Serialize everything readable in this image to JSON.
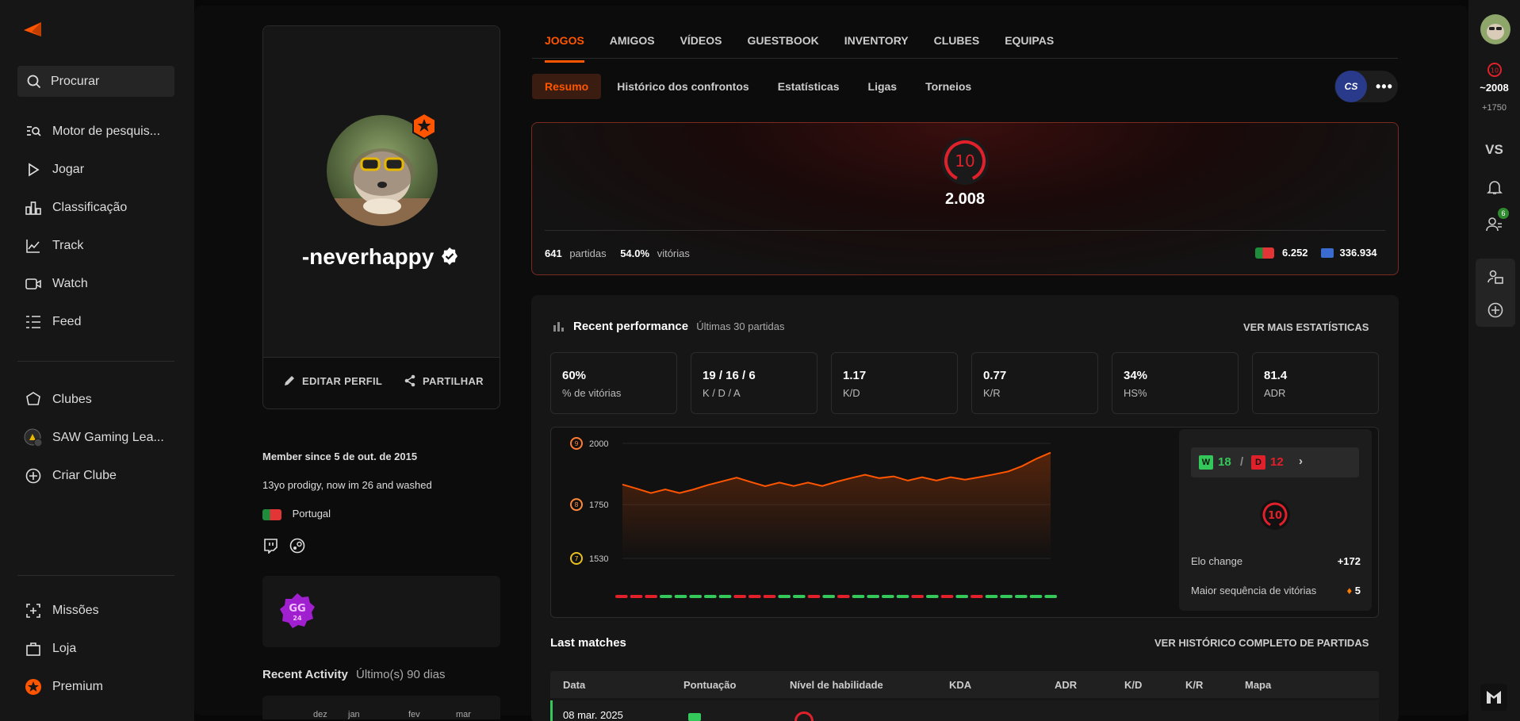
{
  "sidebar": {
    "search": "Procurar",
    "items": [
      {
        "label": "Motor de pesquis...",
        "icon": "search-engine-icon"
      },
      {
        "label": "Jogar",
        "icon": "play-icon"
      },
      {
        "label": "Classificação",
        "icon": "ranking-icon"
      },
      {
        "label": "Track",
        "icon": "chart-line-icon"
      },
      {
        "label": "Watch",
        "icon": "video-icon"
      },
      {
        "label": "Feed",
        "icon": "feed-icon"
      }
    ],
    "clubs": [
      {
        "label": "Clubes",
        "icon": "clubs-icon"
      },
      {
        "label": "SAW Gaming Lea...",
        "icon": "club-avatar"
      },
      {
        "label": "Criar Clube",
        "icon": "plus-circle-icon"
      }
    ],
    "bottom": [
      {
        "label": "Missões",
        "icon": "missions-icon"
      },
      {
        "label": "Loja",
        "icon": "shop-icon"
      },
      {
        "label": "Premium",
        "icon": "premium-icon"
      }
    ]
  },
  "profile": {
    "username": "-neverhappy",
    "edit": "EDITAR PERFIL",
    "share": "PARTILHAR",
    "member_since": "Member since 5 de out. de 2015",
    "bio": "13yo prodigy, now im 26 and washed",
    "country": "Portugal",
    "gg_badge": "GG 24",
    "recent_activity": "Recent Activity",
    "recent_activity_range": "Último(s) 90 dias",
    "activity_months": [
      "dez",
      "jan",
      "fev",
      "mar"
    ]
  },
  "tabs": [
    "JOGOS",
    "AMIGOS",
    "VÍDEOS",
    "GUESTBOOK",
    "INVENTORY",
    "CLUBES",
    "EQUIPAS"
  ],
  "subtabs": [
    "Resumo",
    "Histórico dos confrontos",
    "Estatísticas",
    "Ligas",
    "Torneios"
  ],
  "game_badge": "CS",
  "elo": {
    "level": "10",
    "value": "2.008",
    "matches": "641",
    "matches_label": "partidas",
    "winrate": "54.0%",
    "winrate_label": "vitórias",
    "country_rank": "6.252",
    "region_rank": "336.934"
  },
  "perf": {
    "title": "Recent performance",
    "subtitle": "Últimas 30 partidas",
    "more": "VER MAIS ESTATÍSTICAS",
    "stats": [
      {
        "value": "60%",
        "label": "% de vitórias"
      },
      {
        "value": "19 / 16 / 6",
        "label": "K / D / A"
      },
      {
        "value": "1.17",
        "label": "K/D"
      },
      {
        "value": "0.77",
        "label": "K/R"
      },
      {
        "value": "34%",
        "label": "HS%"
      },
      {
        "value": "81.4",
        "label": "ADR"
      }
    ]
  },
  "chart_data": {
    "type": "area",
    "title": "",
    "yticks": [
      "2000",
      "1750",
      "1530"
    ],
    "ytick_levels": [
      "9",
      "8",
      "7"
    ],
    "ylim": [
      1530,
      2000
    ],
    "values": [
      1832,
      1815,
      1797,
      1812,
      1797,
      1812,
      1830,
      1845,
      1860,
      1842,
      1825,
      1840,
      1826,
      1840,
      1826,
      1843,
      1858,
      1872,
      1858,
      1865,
      1848,
      1862,
      1848,
      1862,
      1852,
      1862,
      1873,
      1885,
      1907,
      1937,
      1962
    ],
    "results": [
      "L",
      "L",
      "L",
      "W",
      "W",
      "W",
      "W",
      "W",
      "L",
      "L",
      "L",
      "W",
      "W",
      "L",
      "W",
      "L",
      "W",
      "W",
      "W",
      "W",
      "L",
      "W",
      "L",
      "W",
      "L",
      "W",
      "W",
      "W",
      "W",
      "W"
    ],
    "colors": {
      "win": "#34c759",
      "loss": "#e0202a",
      "line": "#ff5500"
    }
  },
  "wl": {
    "w": "W",
    "wins": "18",
    "l": "D",
    "losses": "12",
    "sep": "/",
    "level": "10",
    "elo_change_label": "Elo change",
    "elo_change": "+172",
    "streak_label": "Maior sequência de vitórias",
    "streak": "5"
  },
  "matches": {
    "title": "Last matches",
    "more": "VER HISTÓRICO COMPLETO DE PARTIDAS",
    "columns": [
      "Data",
      "Pontuação",
      "Nível de habilidade",
      "KDA",
      "ADR",
      "K/D",
      "K/R",
      "Mapa"
    ],
    "first_date": "08 mar. 2025"
  },
  "rpanel": {
    "level": "10",
    "elo": "~2008",
    "delta": "+1750",
    "vs": "VS",
    "friends_count": "6"
  }
}
